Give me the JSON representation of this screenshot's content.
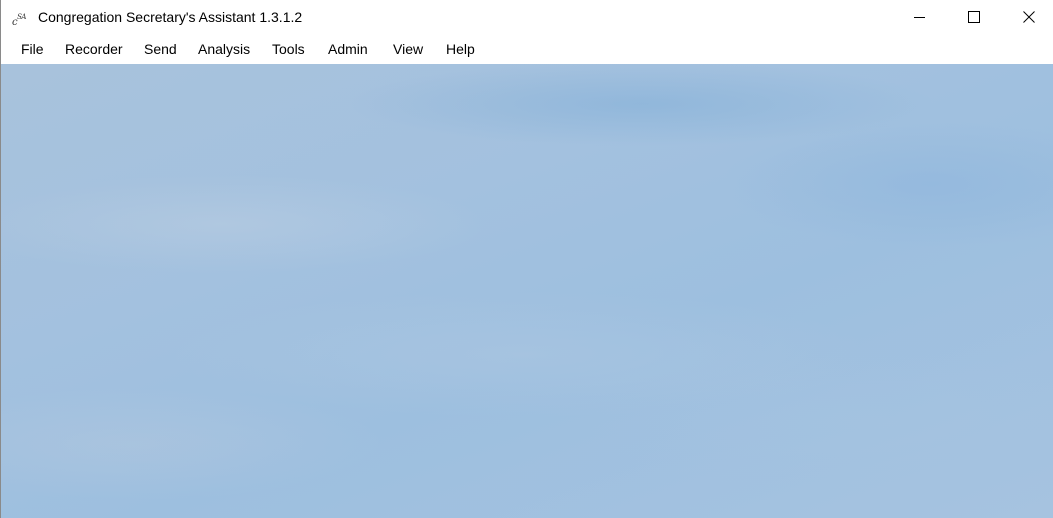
{
  "window": {
    "title": "Congregation Secretary's Assistant 1.3.1.2",
    "icon_text": "CSA",
    "controls": {
      "minimize": "minimize-icon",
      "maximize": "maximize-icon",
      "close": "close-icon"
    }
  },
  "menubar": {
    "items": [
      {
        "label": "File"
      },
      {
        "label": "Recorder"
      },
      {
        "label": "Send"
      },
      {
        "label": "Analysis"
      },
      {
        "label": "Tools"
      },
      {
        "label": "Admin"
      },
      {
        "label": "View"
      },
      {
        "label": "Help"
      }
    ]
  },
  "colors": {
    "background": "#a6c2de",
    "titlebar": "#ffffff",
    "text": "#000000"
  }
}
